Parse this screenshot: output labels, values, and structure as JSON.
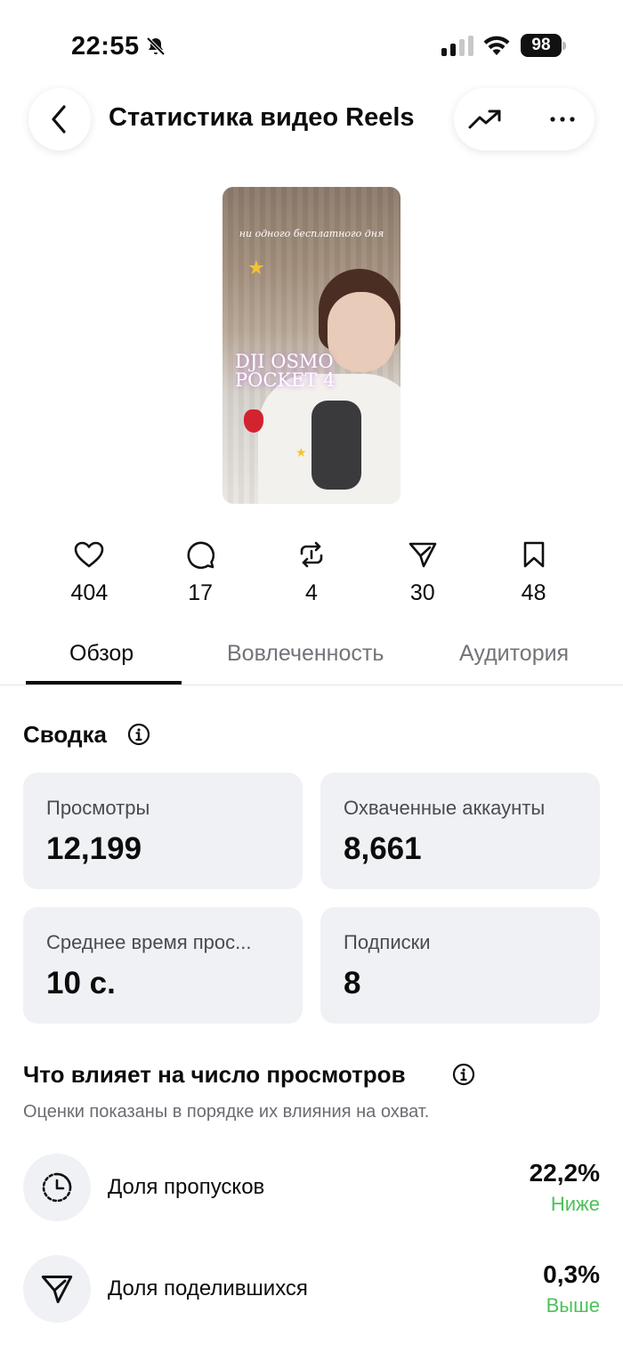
{
  "status_bar": {
    "time": "22:55",
    "battery": "98"
  },
  "header": {
    "title": "Статистика видео Reels"
  },
  "thumbnail": {
    "caption": "ни одного бесплатного дня",
    "overlay_line1": "DJI OSMO",
    "overlay_line2": "POCKET 4"
  },
  "stats": [
    {
      "icon": "heart-icon",
      "value": "404"
    },
    {
      "icon": "comment-icon",
      "value": "17"
    },
    {
      "icon": "repost-icon",
      "value": "4"
    },
    {
      "icon": "share-icon",
      "value": "30"
    },
    {
      "icon": "bookmark-icon",
      "value": "48"
    }
  ],
  "tabs": [
    {
      "label": "Обзор",
      "active": true
    },
    {
      "label": "Вовлеченность",
      "active": false
    },
    {
      "label": "Аудитория",
      "active": false
    }
  ],
  "summary": {
    "title": "Сводка",
    "cards": [
      {
        "label": "Просмотры",
        "value": "12,199"
      },
      {
        "label": "Охваченные аккаунты",
        "value": "8,661"
      },
      {
        "label": "Среднее время прос...",
        "value": "10 с."
      },
      {
        "label": "Подписки",
        "value": "8"
      }
    ]
  },
  "factors": {
    "title": "Что влияет на число просмотров",
    "subtitle": "Оценки показаны в порядке их влияния на охват.",
    "items": [
      {
        "icon": "timer-icon",
        "label": "Доля пропусков",
        "value": "22,2%",
        "trend": "Ниже"
      },
      {
        "icon": "share-icon",
        "label": "Доля поделившихся",
        "value": "0,3%",
        "trend": "Выше"
      }
    ]
  },
  "colors": {
    "accent_positive": "#4cc15a",
    "card_bg": "#eff1f5"
  }
}
